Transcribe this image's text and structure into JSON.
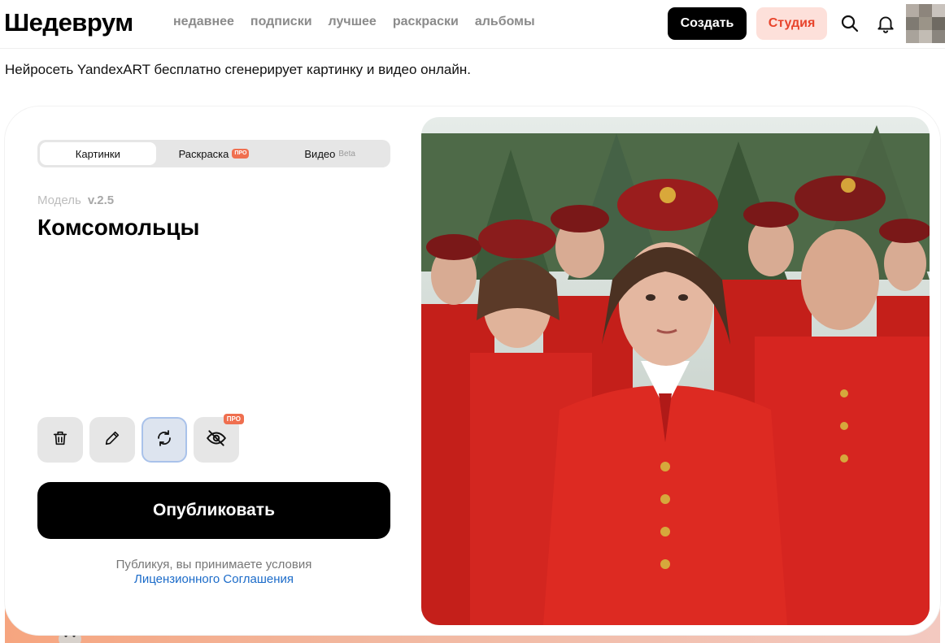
{
  "header": {
    "logo": "Шедеврум",
    "nav": [
      "недавнее",
      "подписки",
      "лучшее",
      "раскраски",
      "альбомы"
    ],
    "create_label": "Создать",
    "studio_label": "Студия",
    "icons": [
      "search-icon",
      "bell-icon"
    ]
  },
  "tagline": "Нейросеть YandexART бесплатно сгенерирует картинку и видео онлайн.",
  "generator": {
    "tabs": [
      {
        "label": "Картинки",
        "active": true
      },
      {
        "label": "Раскраска",
        "badge": "ПРО"
      },
      {
        "label": "Видео",
        "badge": "Beta"
      }
    ],
    "model_label": "Модель",
    "model_version": "v.2.5",
    "prompt": "Комсомольцы",
    "actions": [
      {
        "name": "delete",
        "icon": "trash-icon"
      },
      {
        "name": "edit",
        "icon": "pencil-icon"
      },
      {
        "name": "regenerate",
        "icon": "refresh-icon",
        "selected": true
      },
      {
        "name": "hide",
        "icon": "eye-off-icon",
        "badge": "ПРО"
      }
    ],
    "publish_label": "Опубликовать",
    "terms_text": "Публикуя, вы принимаете условия",
    "terms_link": "Лицензионного Соглашения"
  },
  "colors": {
    "accent_red": "#e8442c",
    "studio_bg": "#fde0da",
    "link_blue": "#1b6bc9",
    "uniform_red": "#d8221c"
  }
}
